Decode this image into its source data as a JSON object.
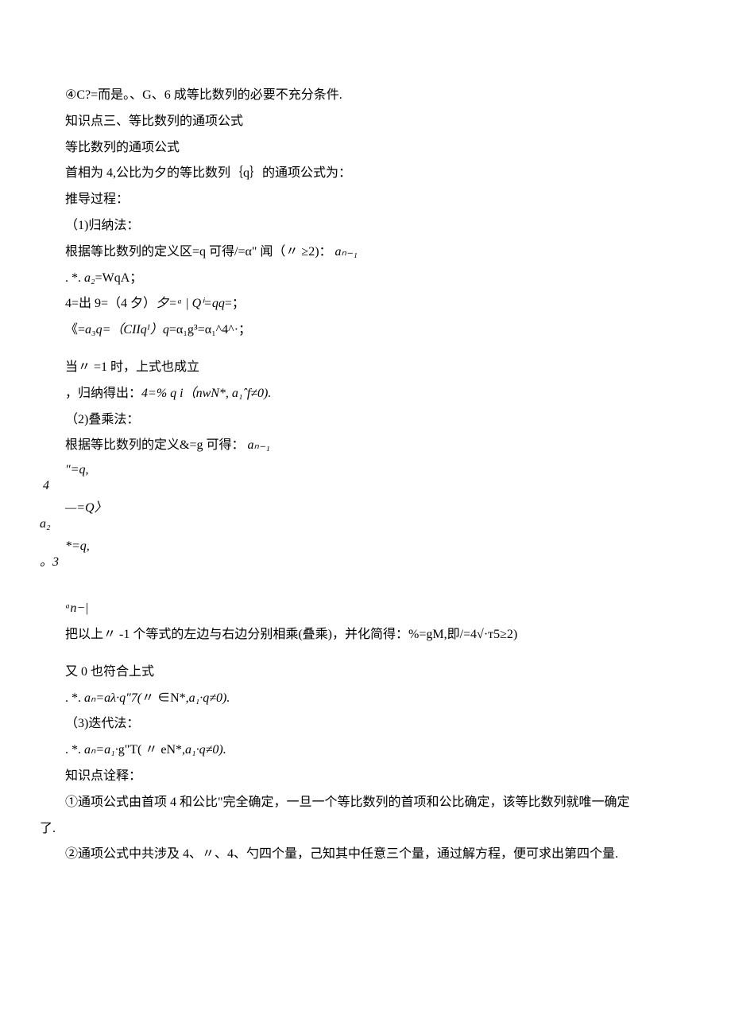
{
  "p1": "④C?=而是。、G、6 成等比数列的必要不充分条件.",
  "p2": "知识点三、等比数列的通项公式",
  "p3": "等比数列的通项公式",
  "p4": "首相为 4,公比为夕的等比数列｛q｝的通项公式为：",
  "p5": "推导过程：",
  "p6": "（1)归纳法：",
  "p7_a": "根据等比数列的定义区=q 可得/=α\" 闻（〃 ≥2)：",
  "p7_b": "aₙ₋₁",
  "p8_a": ". *. ",
  "p8_b": "a₂",
  "p8_c": "=WqA；",
  "p9_a": "4=出 9=（4 夕）",
  "p9_b": "夕=ᵃ | Qⁱ=qq",
  "p9_c": "=；",
  "p10_a": "《=",
  "p10_b": "a₃q=（CIIqᴵ）q",
  "p10_c": "=α₁g³=α₁^4^·；",
  "p11": "当〃 =1 时，上式也成立",
  "p12_a": "，归纳得出：",
  "p12_b": "4=% q i（nwN*, a₁ˆf≠0).",
  "p13": "（2)叠乘法：",
  "p14_a": "根据等比数列的定义&=g 可得：",
  "p14_b": "aₙ₋₁",
  "p15": "″=q,\n 4",
  "p16": "—=Q〉\na₂",
  "p17": "*=q,\n。3",
  "p18": "ᵃn−|",
  "p19": "把以上〃 -1 个等式的左边与右边分别相乘(叠乘)，并化简得：%=gM,即/=4√·т5≥2)",
  "p20": "又 0 也符合上式",
  "p21_a": ". *. ",
  "p21_b": "aₙ=aλ·q″7(",
  "p21_c": "〃 ∈N*,",
  "p21_d": "a₁·q≠0).",
  "p22": "（3)迭代法：",
  "p23_a": ". *. ",
  "p23_b": "aₙ=a₁·",
  "p23_c": "g\"T( 〃 eN*,",
  "p23_d": "a₁·q≠0).",
  "p24": "知识点诠释：",
  "p25": "①通项公式由首项 4 和公比\"完全确定，一旦一个等比数列的首项和公比确定，该等比数列就唯一确定",
  "p26": "了.",
  "p27": "②通项公式中共涉及 4、〃、4、勺四个量，己知其中任意三个量，通过解方程，便可求出第四个量."
}
